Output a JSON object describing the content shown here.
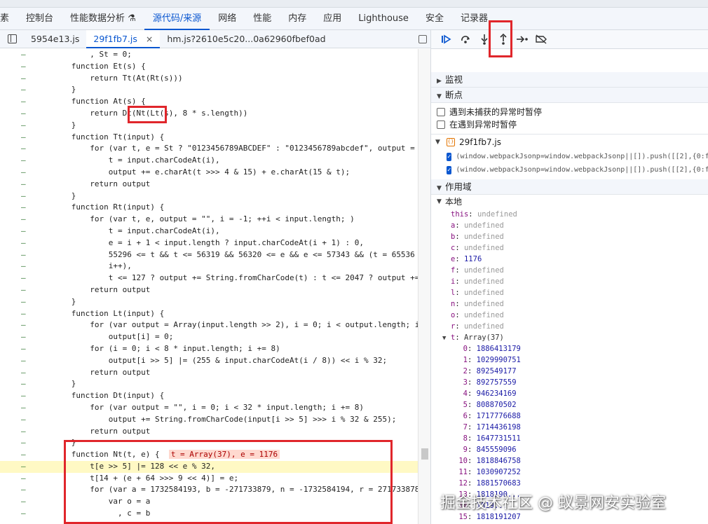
{
  "toptabs": [
    "素",
    "控制台",
    "性能数据分析 ⚗",
    "源代码/来源",
    "网络",
    "性能",
    "内存",
    "应用",
    "Lighthouse",
    "安全",
    "记录器"
  ],
  "filetabs": {
    "t1": "5954e13.js",
    "t2": "29f1fb7.js",
    "t2_close": "×",
    "t3": "hm.js?2610e5c20...0a62960fbef0ad"
  },
  "code": [
    {
      "g": "–",
      "t": "          , St = 0;"
    },
    {
      "g": "–",
      "t": "      function Et(s) {"
    },
    {
      "g": "–",
      "t": "          return Tt(At(Rt(s)))"
    },
    {
      "g": "–",
      "t": "      }"
    },
    {
      "g": "–",
      "t": "      function At(s) {"
    },
    {
      "g": "–",
      "t": "          return Dt(Nt(Lt(s), 8 * s.length))"
    },
    {
      "g": "–",
      "t": "      }"
    },
    {
      "g": "–",
      "t": "      function Tt(input) {"
    },
    {
      "g": "–",
      "t": "          for (var t, e = St ? \"0123456789ABCDEF\" : \"0123456789abcdef\", output = \"\", i ="
    },
    {
      "g": "–",
      "t": "              t = input.charCodeAt(i),"
    },
    {
      "g": "–",
      "t": "              output += e.charAt(t >>> 4 & 15) + e.charAt(15 & t);"
    },
    {
      "g": "–",
      "t": "          return output"
    },
    {
      "g": "–",
      "t": "      }"
    },
    {
      "g": "–",
      "t": "      function Rt(input) {"
    },
    {
      "g": "–",
      "t": "          for (var t, e, output = \"\", i = -1; ++i < input.length; )"
    },
    {
      "g": "–",
      "t": "              t = input.charCodeAt(i),"
    },
    {
      "g": "–",
      "t": "              e = i + 1 < input.length ? input.charCodeAt(i + 1) : 0,"
    },
    {
      "g": "–",
      "t": "              55296 <= t && t <= 56319 && 56320 <= e && e <= 57343 && (t = 65536 + ((10"
    },
    {
      "g": "–",
      "t": "              i++),"
    },
    {
      "g": "–",
      "t": "              t <= 127 ? output += String.fromCharCode(t) : t <= 2047 ? output += Strin"
    },
    {
      "g": "–",
      "t": "          return output"
    },
    {
      "g": "–",
      "t": "      }"
    },
    {
      "g": "–",
      "t": "      function Lt(input) {"
    },
    {
      "g": "–",
      "t": "          for (var output = Array(input.length >> 2), i = 0; i < output.length; i++)"
    },
    {
      "g": "–",
      "t": "              output[i] = 0;"
    },
    {
      "g": "–",
      "t": "          for (i = 0; i < 8 * input.length; i += 8)"
    },
    {
      "g": "–",
      "t": "              output[i >> 5] |= (255 & input.charCodeAt(i / 8)) << i % 32;"
    },
    {
      "g": "–",
      "t": "          return output"
    },
    {
      "g": "–",
      "t": "      }"
    },
    {
      "g": "–",
      "t": "      function Dt(input) {"
    },
    {
      "g": "–",
      "t": "          for (var output = \"\", i = 0; i < 32 * input.length; i += 8)"
    },
    {
      "g": "–",
      "t": "              output += String.fromCharCode(input[i >> 5] >>> i % 32 & 255);"
    },
    {
      "g": "–",
      "t": "          return output"
    },
    {
      "g": "–",
      "t": "      }"
    },
    {
      "g": "–",
      "t": "      function Nt(t, e) {  ",
      "inl": "t = Array(37), e = 1176"
    },
    {
      "g": "–",
      "t": "          t[e >> 5] |= 128 << e % 32,",
      "hl": true
    },
    {
      "g": "–",
      "t": "          t[14 + (e + 64 >>> 9 << 4)] = e;"
    },
    {
      "g": "–",
      "t": "          for (var a = 1732584193, b = -271733879, n = -1732584194, r = 271733878, i = 0"
    },
    {
      "g": "–",
      "t": "              var o = a"
    },
    {
      "g": "–",
      "t": "                , c = b"
    }
  ],
  "right": {
    "watch": "监视",
    "breakpoints": "断点",
    "cb1": "遇到未捕获的异常时暂停",
    "cb2": "在遇到异常时暂停",
    "bpfile": "29f1fb7.js",
    "bp1": "(window.webpackJsonp=window.webpackJsonp||[]).push([[2],{0:f",
    "bp2": "(window.webpackJsonp=window.webpackJsonp||[]).push([[2],{0:f",
    "scope": "作用域",
    "local": "本地",
    "vars": [
      {
        "k": "this",
        "v": "undefined"
      },
      {
        "k": "a",
        "v": "undefined"
      },
      {
        "k": "b",
        "v": "undefined"
      },
      {
        "k": "c",
        "v": "undefined"
      },
      {
        "k": "e",
        "v": "1176",
        "num": true
      },
      {
        "k": "f",
        "v": "undefined"
      },
      {
        "k": "i",
        "v": "undefined"
      },
      {
        "k": "l",
        "v": "undefined"
      },
      {
        "k": "n",
        "v": "undefined"
      },
      {
        "k": "o",
        "v": "undefined"
      },
      {
        "k": "r",
        "v": "undefined"
      }
    ],
    "t_label": "t",
    "t_value": "Array(37)",
    "arr": [
      {
        "k": "0",
        "v": "1886413179"
      },
      {
        "k": "1",
        "v": "1029990751"
      },
      {
        "k": "2",
        "v": "892549177"
      },
      {
        "k": "3",
        "v": "892757559"
      },
      {
        "k": "4",
        "v": "946234169"
      },
      {
        "k": "5",
        "v": "808870502"
      },
      {
        "k": "6",
        "v": "1717776688"
      },
      {
        "k": "7",
        "v": "1714436198"
      },
      {
        "k": "8",
        "v": "1647731511"
      },
      {
        "k": "9",
        "v": "845559096"
      },
      {
        "k": "10",
        "v": "1818846758"
      },
      {
        "k": "11",
        "v": "1030907252"
      },
      {
        "k": "12",
        "v": "1881570683"
      },
      {
        "k": "13",
        "v": "1818190..."
      },
      {
        "k": "14",
        "v": "1819..."
      },
      {
        "k": "15",
        "v": "1818191207"
      }
    ]
  },
  "watermark": "掘金技术社区 @ 蚁景网安实验室"
}
